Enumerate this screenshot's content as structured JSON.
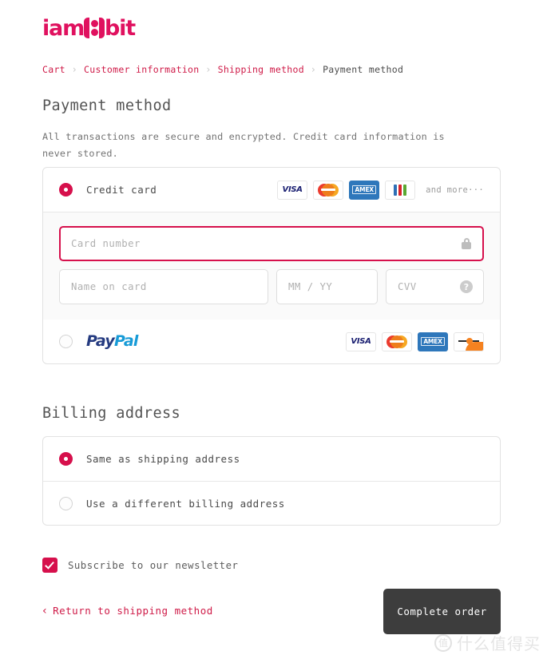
{
  "brand": {
    "logo_prefix": "iam",
    "logo_suffix": "bit",
    "logo_alt": "iam8bit",
    "color": "#e0115f"
  },
  "breadcrumb": {
    "items": [
      {
        "label": "Cart",
        "current": false
      },
      {
        "label": "Customer information",
        "current": false
      },
      {
        "label": "Shipping method",
        "current": false
      },
      {
        "label": "Payment method",
        "current": true
      }
    ],
    "separator": "›"
  },
  "payment_section": {
    "title": "Payment method",
    "subtitle": "All transactions are secure and encrypted. Credit card information is never stored.",
    "methods": [
      {
        "id": "credit-card",
        "label": "Credit card",
        "selected": true,
        "brands": [
          "VISA",
          "Mastercard",
          "AMEX",
          "JCB"
        ],
        "and_more": "and more···"
      },
      {
        "id": "paypal",
        "label_a": "Pay",
        "label_b": "Pal",
        "label": "PayPal",
        "selected": false,
        "brands": [
          "VISA",
          "Mastercard",
          "AMEX",
          "Discover"
        ]
      }
    ],
    "fields": {
      "card_number": {
        "placeholder": "Card number",
        "value": "",
        "focused": true,
        "icon": "lock-icon"
      },
      "name_on_card": {
        "placeholder": "Name on card",
        "value": ""
      },
      "expiry": {
        "placeholder": "MM / YY",
        "value": ""
      },
      "cvv": {
        "placeholder": "CVV",
        "value": "",
        "icon": "question-mark-icon"
      }
    }
  },
  "billing_section": {
    "title": "Billing address",
    "options": [
      {
        "id": "same-as-shipping",
        "label": "Same as shipping address",
        "selected": true
      },
      {
        "id": "different-billing",
        "label": "Use a different billing address",
        "selected": false
      }
    ]
  },
  "newsletter": {
    "label": "Subscribe to our newsletter",
    "checked": true
  },
  "actions": {
    "return_label": "Return to shipping method",
    "return_chevron": "‹",
    "complete_label": "Complete order"
  },
  "watermark": {
    "mark": "值",
    "text": "什么值得买"
  },
  "brand_labels": {
    "visa": "VISA",
    "amex": "AMEX"
  }
}
